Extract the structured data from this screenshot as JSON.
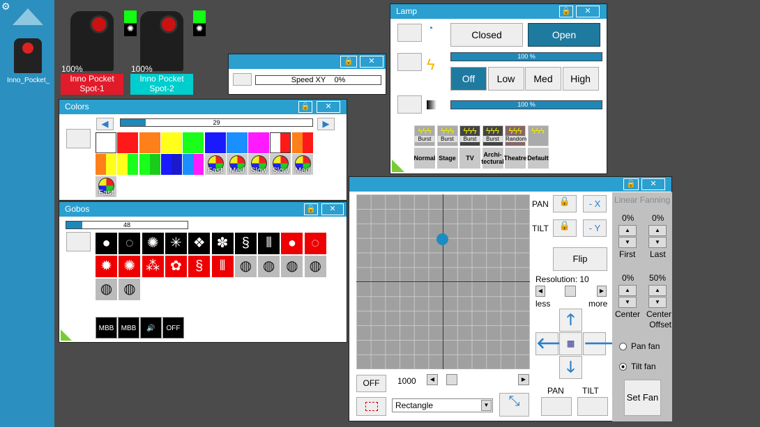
{
  "sidebar": {
    "fixture_label": "Inno_Pocket_"
  },
  "fixtures": [
    {
      "name": "Inno Pocket Spot-1",
      "percent": "100%",
      "color": "#e21b2a"
    },
    {
      "name": "Inno Pocket Spot-2",
      "percent": "100%",
      "color": "#00cdcd"
    }
  ],
  "speed": {
    "label": "Speed XY",
    "value": "0%"
  },
  "colors": {
    "title": "Colors",
    "slider_value": "29",
    "slider_fraction": 0.13,
    "row1": [
      "#ffffff",
      "#ff1a1a",
      "#ff7f1a",
      "#ffff1a",
      "#1aff1a",
      "#1a1aff",
      "#1a8fff",
      "#ff1aff",
      "split:#ffffff:#ff1a1a",
      "split:#ff7f1a:#ff1a1a"
    ],
    "row2": [
      "split:#ff7f1a:#ffff1a",
      "split:#ffff1a:#1aff1a",
      "split:#1aff1a:#1acc1a",
      "split:#1a1aff:#1a1acc",
      "split:#1a8fff:#ff1aff"
    ],
    "wheels": [
      "Fast",
      "Med",
      "Slow",
      "Slow",
      "Med",
      "Fast"
    ]
  },
  "gobos": {
    "title": "Gobos",
    "slider_value": "48",
    "slider_fraction": 0.13,
    "specials": [
      "MBB",
      "MBB",
      "🔊",
      "OFF"
    ]
  },
  "lamp": {
    "title": "Lamp",
    "closed": "Closed",
    "open": "Open",
    "intensity": "100 %",
    "dimmer": "100 %",
    "levels": [
      "Off",
      "Low",
      "Med",
      "High"
    ],
    "effects": [
      "Burst",
      "Burst",
      "Burst",
      "Burst",
      "Random",
      ""
    ],
    "modes": [
      "Normal",
      "Stage",
      "TV",
      "Archi-tectural",
      "Theatre",
      "Default"
    ]
  },
  "position": {
    "pan": "PAN",
    "tilt": "TILT",
    "minus_x": "- X",
    "minus_y": "- Y",
    "flip": "Flip",
    "resolution": "Resolution: 10",
    "less": "less",
    "more": "more",
    "off": "OFF",
    "speed_value": "1000",
    "shape": "Rectangle",
    "pan_label": "PAN",
    "tilt_label": "TILT",
    "fanning": {
      "title": "Linear Fanning",
      "first": "0%",
      "last": "0%",
      "center": "0%",
      "offset": "50%",
      "first_lbl": "First",
      "last_lbl": "Last",
      "center_lbl": "Center",
      "offset_lbl": "Center Offset",
      "pan_fan": "Pan fan",
      "tilt_fan": "Tilt fan",
      "set_fan": "Set Fan"
    }
  }
}
